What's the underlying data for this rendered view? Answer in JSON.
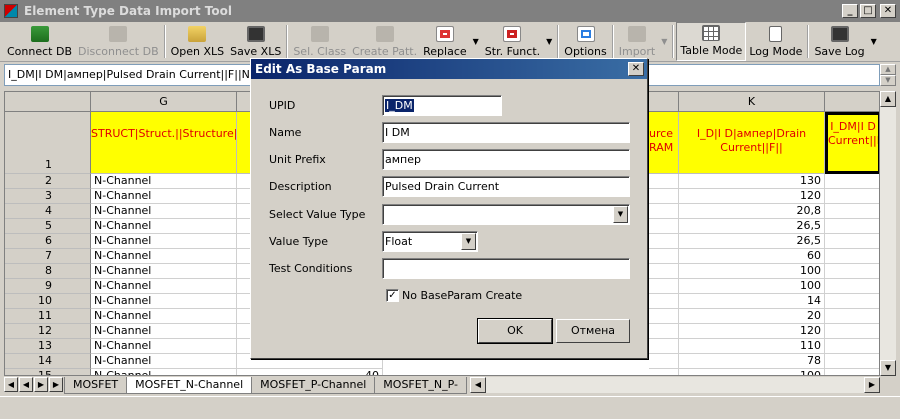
{
  "window": {
    "title": "Element Type Data Import Tool"
  },
  "toolbar": {
    "connect_db": "Connect DB",
    "disconnect_db": "Disconnect DB",
    "open_xls": "Open XLS",
    "save_xls": "Save XLS",
    "sel_class": "Sel. Class",
    "create_patt": "Create Patt.",
    "replace": "Replace",
    "str_funct": "Str. Funct.",
    "options": "Options",
    "import": "Import",
    "table_mode": "Table Mode",
    "log_mode": "Log Mode",
    "save_log": "Save Log"
  },
  "formula_bar": {
    "value": "I_DM|I DM|ампер|Pulsed Drain Current||F||NOBAS"
  },
  "grid": {
    "col_g": "G",
    "col_k": "K",
    "header_row_num": "1",
    "header_g": "STRUCT|Struct.||Structure|4|S||",
    "header_j_fragment": "urce\nRAM",
    "header_k": "I_D|I D|ампер|Drain Current||F||",
    "header_l": "I_DM|I D\nCurrent||F|",
    "rows": [
      {
        "n": "2",
        "g": "N-Channel",
        "k": "130"
      },
      {
        "n": "3",
        "g": "N-Channel",
        "k": "120"
      },
      {
        "n": "4",
        "g": "N-Channel",
        "k": "20,8"
      },
      {
        "n": "5",
        "g": "N-Channel",
        "k": "26,5"
      },
      {
        "n": "6",
        "g": "N-Channel",
        "k": "26,5"
      },
      {
        "n": "7",
        "g": "N-Channel",
        "k": "60"
      },
      {
        "n": "8",
        "g": "N-Channel",
        "k": "100"
      },
      {
        "n": "9",
        "g": "N-Channel",
        "k": "100"
      },
      {
        "n": "10",
        "g": "N-Channel",
        "k": "14"
      },
      {
        "n": "11",
        "g": "N-Channel",
        "k": "20"
      },
      {
        "n": "12",
        "g": "N-Channel",
        "k": "120"
      },
      {
        "n": "13",
        "g": "N-Channel",
        "k": "110"
      },
      {
        "n": "14",
        "g": "N-Channel",
        "k": "78"
      },
      {
        "n": "15",
        "g": "N-Channel",
        "k": "100",
        "h": "40"
      }
    ]
  },
  "sheet_tabs": [
    "MOSFET",
    "MOSFET_N-Channel",
    "MOSFET_P-Channel",
    "MOSFET_N_P-"
  ],
  "dialog": {
    "title": "Edit As Base Param",
    "upid_label": "UPID",
    "upid_value": "I_DM",
    "name_label": "Name",
    "name_value": "I DM",
    "unit_prefix_label": "Unit Prefix",
    "unit_prefix_value": "ампер",
    "description_label": "Description",
    "description_value": "Pulsed Drain Current",
    "select_value_type_label": "Select Value Type",
    "select_value_type_value": "",
    "value_type_label": "Value Type",
    "value_type_value": "Float",
    "test_conditions_label": "Test Conditions",
    "test_conditions_value": "",
    "no_baseparam_label": "No BaseParam Create",
    "no_baseparam_checked": "✓",
    "ok_label": "OK",
    "cancel_label": "Отмена"
  }
}
